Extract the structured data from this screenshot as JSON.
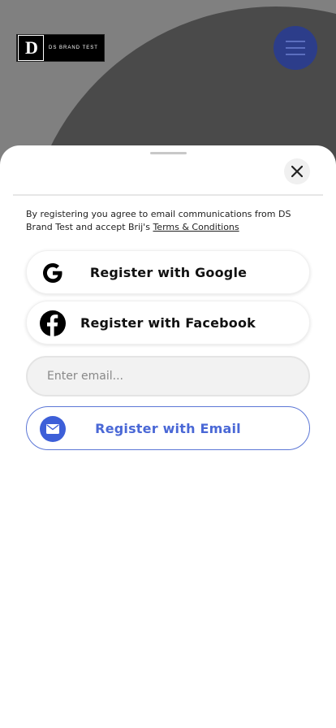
{
  "background": {
    "logo_text": "DS BRAND TEST",
    "logo_mark": "D",
    "menu_icon": "hamburger-icon"
  },
  "sheet": {
    "close_icon": "close-icon",
    "consent_text": "By registering you agree to email communications from DS Brand Test and accept Brij's ",
    "terms_link": "Terms & Conditions",
    "google_label": "Register with Google",
    "facebook_label": "Register with Facebook",
    "email_placeholder": "Enter email...",
    "email_value": "",
    "email_button_label": "Register with Email"
  },
  "colors": {
    "accent": "#3d5fd8",
    "menu_button": "#2c3d8a",
    "backdrop": "#808080"
  }
}
